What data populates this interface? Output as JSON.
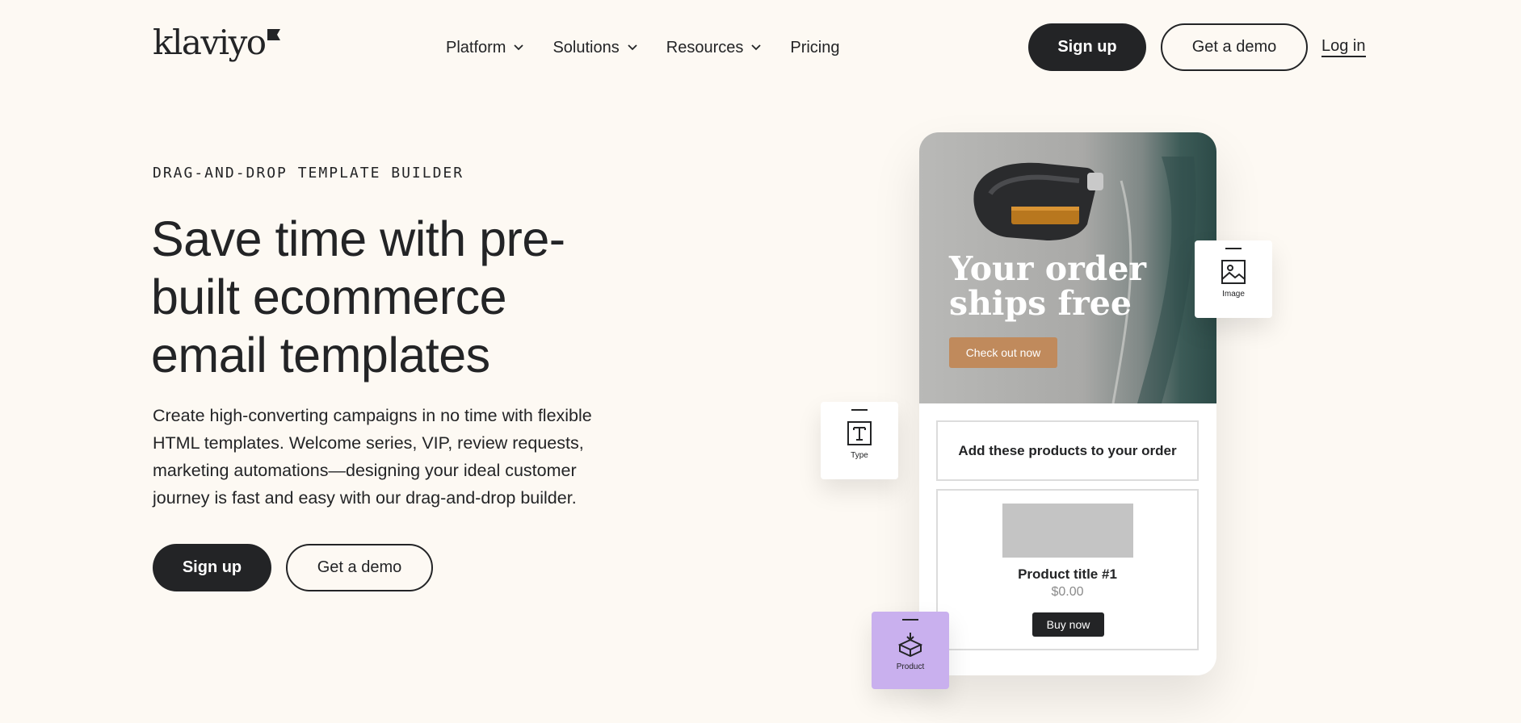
{
  "brand": {
    "logo_text": "klaviyo"
  },
  "nav": {
    "items": [
      {
        "label": "Platform",
        "dropdown": true
      },
      {
        "label": "Solutions",
        "dropdown": true
      },
      {
        "label": "Resources",
        "dropdown": true
      },
      {
        "label": "Pricing",
        "dropdown": false
      }
    ]
  },
  "header": {
    "signup_label": "Sign up",
    "demo_label": "Get a demo",
    "login_label": "Log in"
  },
  "hero": {
    "eyebrow": "DRAG-AND-DROP TEMPLATE BUILDER",
    "headline": "Save time with pre-built ecommerce email templates",
    "description": "Create high-converting campaigns in no time with flexible HTML templates. Welcome series, VIP, review requests, marketing automations—designing your ideal customer journey is fast and easy with our drag-and-drop builder.",
    "signup_label": "Sign up",
    "demo_label": "Get a demo"
  },
  "mockup": {
    "headline": "Your order ships free",
    "cta_label": "Check out now",
    "block_title": "Add these products to your order",
    "product_title": "Product title #1",
    "product_price": "$0.00",
    "buy_label": "Buy now"
  },
  "tiles": {
    "image_label": "Image",
    "type_label": "Type",
    "product_label": "Product"
  },
  "colors": {
    "background": "#fdf9f3",
    "ink": "#232426",
    "cta_copper": "#c08a5c",
    "product_tile": "#c9b0ee"
  }
}
